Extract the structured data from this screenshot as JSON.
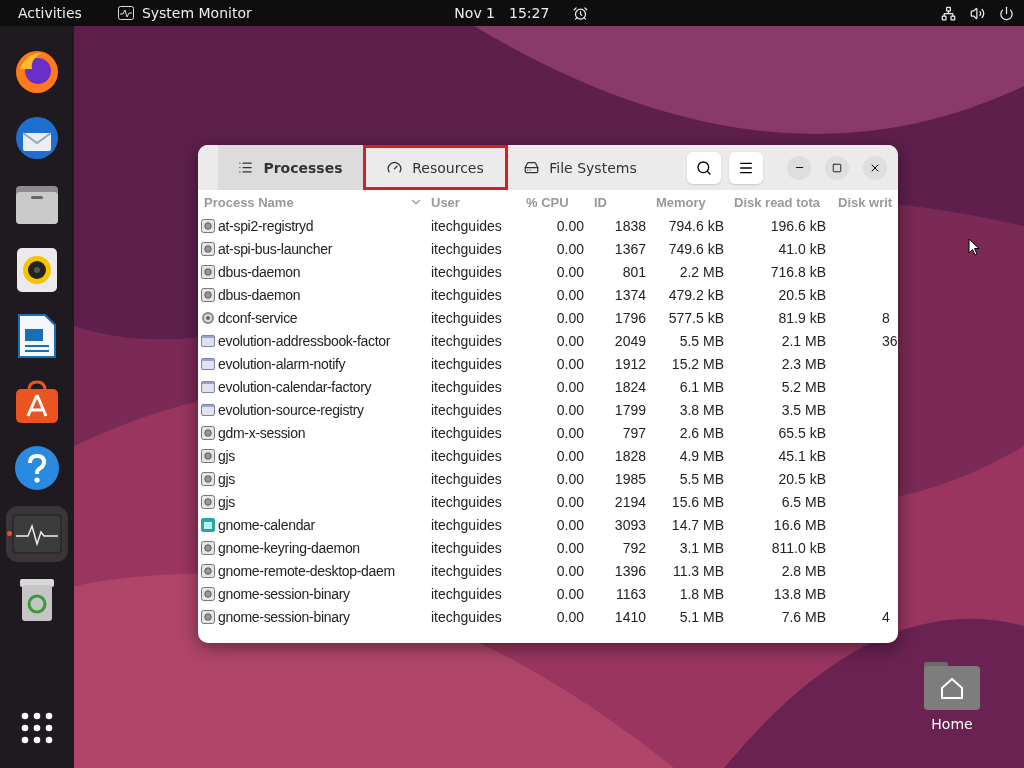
{
  "top_bar": {
    "activities": "Activities",
    "app_name": "System Monitor",
    "date": "Nov 1",
    "time": "15:27"
  },
  "dock": {
    "items": [
      {
        "kind": "firefox",
        "active": false
      },
      {
        "kind": "mail",
        "active": false
      },
      {
        "kind": "files",
        "active": false
      },
      {
        "kind": "music",
        "active": false
      },
      {
        "kind": "writer",
        "active": false
      },
      {
        "kind": "software",
        "active": false
      },
      {
        "kind": "help",
        "active": false
      },
      {
        "kind": "monitor",
        "active": true
      },
      {
        "kind": "trash",
        "active": false
      }
    ]
  },
  "window": {
    "tabs": [
      {
        "label": "Processes",
        "kind": "list",
        "selected": true,
        "highlighted": false
      },
      {
        "label": "Resources",
        "kind": "gauge",
        "selected": false,
        "highlighted": true
      },
      {
        "label": "File Systems",
        "kind": "disk",
        "selected": false,
        "highlighted": false
      }
    ],
    "table": {
      "columns": [
        "Process Name",
        "User",
        "% CPU",
        "ID",
        "Memory",
        "Disk read tota",
        "Disk writ"
      ],
      "rows": [
        {
          "kind": "generic",
          "cells": [
            "at-spi2-registryd",
            "itechguides",
            "0.00",
            "1838",
            "794.6 kB",
            "196.6 kB",
            ""
          ]
        },
        {
          "kind": "generic",
          "cells": [
            "at-spi-bus-launcher",
            "itechguides",
            "0.00",
            "1367",
            "749.6 kB",
            "41.0 kB",
            ""
          ]
        },
        {
          "kind": "generic",
          "cells": [
            "dbus-daemon",
            "itechguides",
            "0.00",
            "801",
            "2.2 MB",
            "716.8 kB",
            ""
          ]
        },
        {
          "kind": "generic",
          "cells": [
            "dbus-daemon",
            "itechguides",
            "0.00",
            "1374",
            "479.2 kB",
            "20.5 kB",
            ""
          ]
        },
        {
          "kind": "gear",
          "cells": [
            "dconf-service",
            "itechguides",
            "0.00",
            "1796",
            "577.5 kB",
            "81.9 kB",
            "8"
          ]
        },
        {
          "kind": "window",
          "cells": [
            "evolution-addressbook-factor",
            "itechguides",
            "0.00",
            "2049",
            "5.5 MB",
            "2.1 MB",
            "36"
          ]
        },
        {
          "kind": "window",
          "cells": [
            "evolution-alarm-notify",
            "itechguides",
            "0.00",
            "1912",
            "15.2 MB",
            "2.3 MB",
            ""
          ]
        },
        {
          "kind": "window",
          "cells": [
            "evolution-calendar-factory",
            "itechguides",
            "0.00",
            "1824",
            "6.1 MB",
            "5.2 MB",
            ""
          ]
        },
        {
          "kind": "window",
          "cells": [
            "evolution-source-registry",
            "itechguides",
            "0.00",
            "1799",
            "3.8 MB",
            "3.5 MB",
            ""
          ]
        },
        {
          "kind": "generic",
          "cells": [
            "gdm-x-session",
            "itechguides",
            "0.00",
            "797",
            "2.6 MB",
            "65.5 kB",
            ""
          ]
        },
        {
          "kind": "generic",
          "cells": [
            "gjs",
            "itechguides",
            "0.00",
            "1828",
            "4.9 MB",
            "45.1 kB",
            ""
          ]
        },
        {
          "kind": "generic",
          "cells": [
            "gjs",
            "itechguides",
            "0.00",
            "1985",
            "5.5 MB",
            "20.5 kB",
            ""
          ]
        },
        {
          "kind": "generic",
          "cells": [
            "gjs",
            "itechguides",
            "0.00",
            "2194",
            "15.6 MB",
            "6.5 MB",
            ""
          ]
        },
        {
          "kind": "calendar",
          "cells": [
            "gnome-calendar",
            "itechguides",
            "0.00",
            "3093",
            "14.7 MB",
            "16.6 MB",
            ""
          ]
        },
        {
          "kind": "generic",
          "cells": [
            "gnome-keyring-daemon",
            "itechguides",
            "0.00",
            "792",
            "3.1 MB",
            "811.0 kB",
            ""
          ]
        },
        {
          "kind": "generic",
          "cells": [
            "gnome-remote-desktop-daem",
            "itechguides",
            "0.00",
            "1396",
            "11.3 MB",
            "2.8 MB",
            ""
          ]
        },
        {
          "kind": "generic",
          "cells": [
            "gnome-session-binary",
            "itechguides",
            "0.00",
            "1163",
            "1.8 MB",
            "13.8 MB",
            ""
          ]
        },
        {
          "kind": "generic",
          "cells": [
            "gnome-session-binary",
            "itechguides",
            "0.00",
            "1410",
            "5.1 MB",
            "7.6 MB",
            "4"
          ]
        }
      ]
    }
  },
  "desktop": {
    "home_label": "Home"
  }
}
